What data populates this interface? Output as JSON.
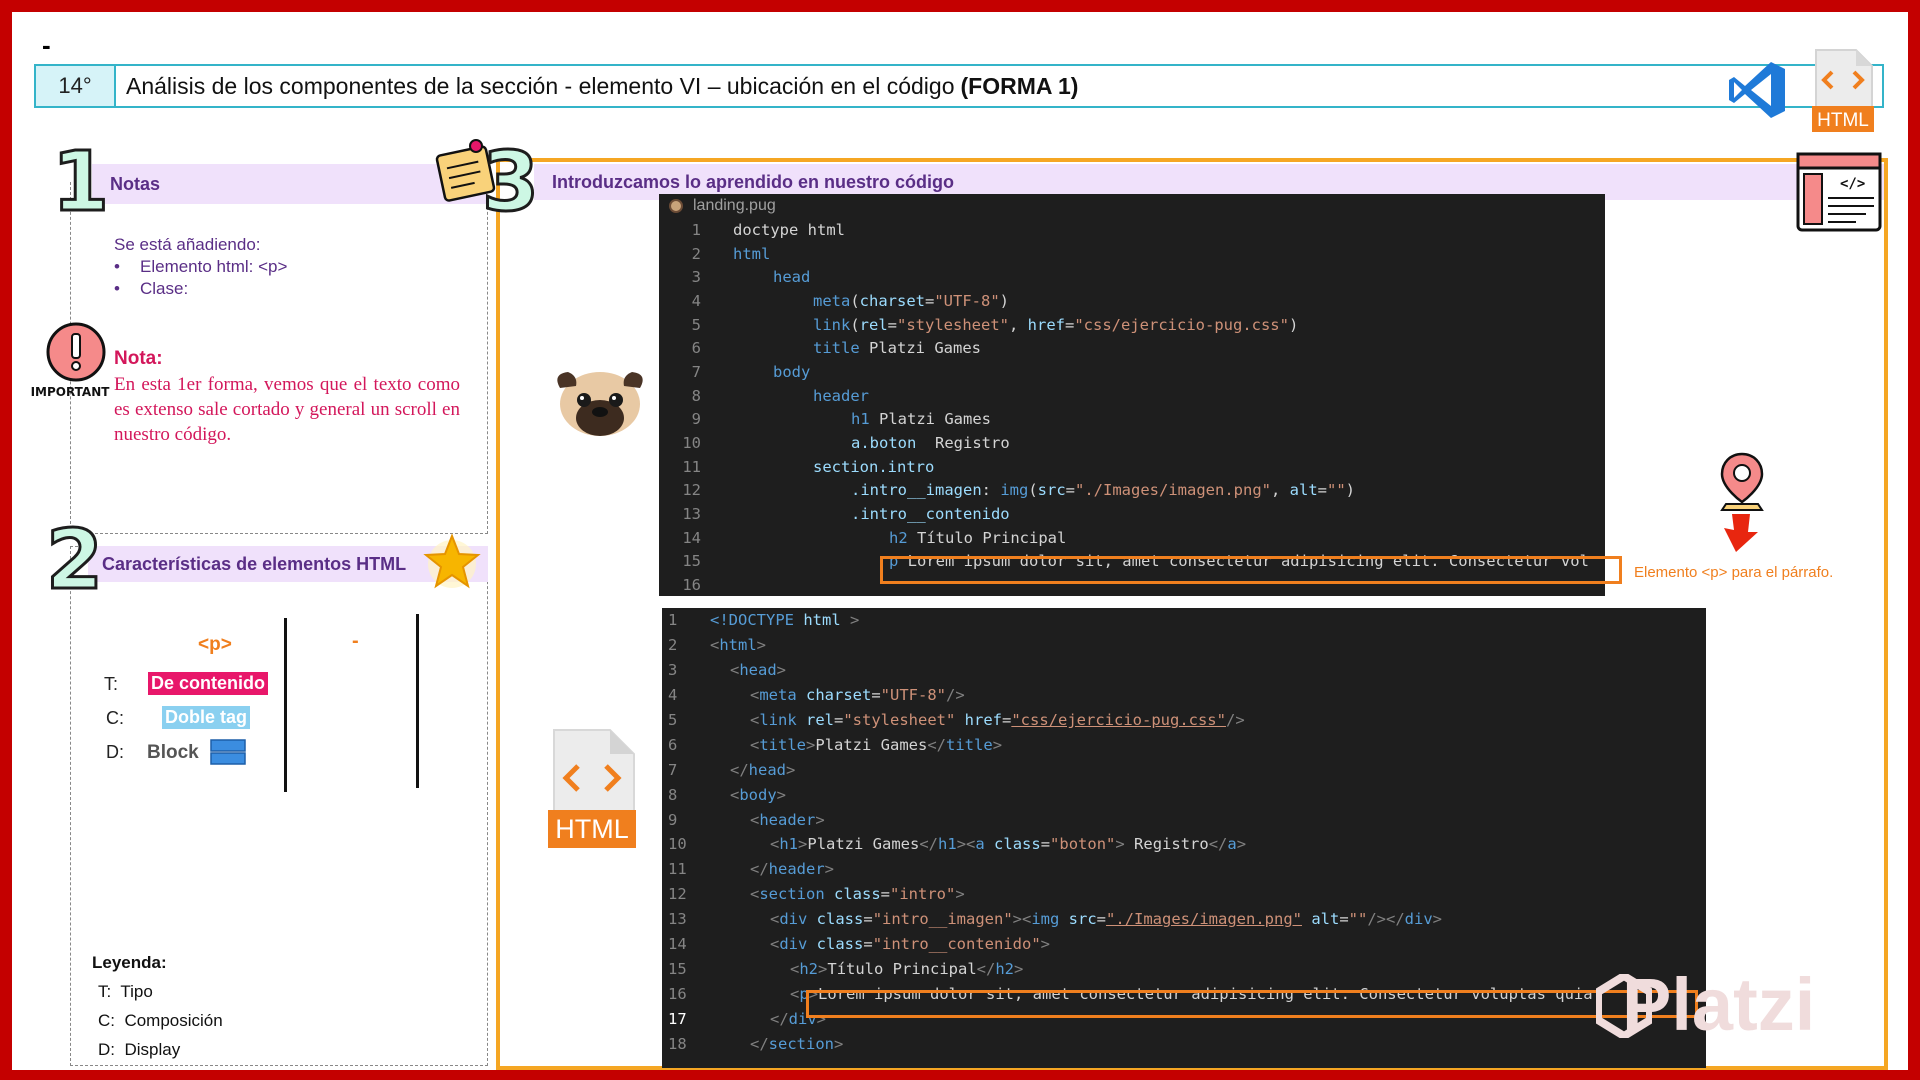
{
  "top": {
    "dash": "-"
  },
  "title_bar": {
    "number": "14°",
    "text": "Análisis de los componentes de la sección   - elemento VI – ubicación en el código",
    "bold_text": "(FORMA 1)"
  },
  "icons": {
    "vscode": "vscode-logo-icon",
    "html_file": "html-file-icon",
    "html_file_label": "HTML"
  },
  "notes": {
    "number": "1",
    "heading": "Notas",
    "intro": "Se está añadiendo:",
    "items": [
      "Elemento html: <p>",
      "Clase:"
    ],
    "important_label": "IMPORTANT",
    "nota_title": "Nota:",
    "nota_text": "En esta 1er forma, vemos que el texto como es extenso sale cortado y general un scroll en nuestro código."
  },
  "features": {
    "number": "2",
    "heading": "Características de elementos HTML",
    "column1_tag": "<p>",
    "column2_tag": "-",
    "rows": [
      {
        "label": "T:",
        "value": "De contenido"
      },
      {
        "label": "C:",
        "value": "Doble tag"
      },
      {
        "label": "D:",
        "value": "Block"
      }
    ],
    "legend_title": "Leyenda:",
    "legend": [
      {
        "key": "T:",
        "text": "Tipo"
      },
      {
        "key": "C:",
        "text": "Composición"
      },
      {
        "key": "D:",
        "text": "Display"
      }
    ]
  },
  "right": {
    "number": "3",
    "heading": "Introduzcamos lo aprendido en nuestro código",
    "pug_file_name": "landing.pug",
    "annotation": "Elemento <p> para el párrafo.",
    "watermark": "Platzi"
  },
  "pug_code": [
    {
      "n": "1"
    },
    {
      "n": "2"
    },
    {
      "n": "3"
    },
    {
      "n": "4"
    },
    {
      "n": "5"
    },
    {
      "n": "6"
    },
    {
      "n": "7"
    },
    {
      "n": "8"
    },
    {
      "n": "9"
    },
    {
      "n": "10"
    },
    {
      "n": "11"
    },
    {
      "n": "12"
    },
    {
      "n": "13"
    },
    {
      "n": "14"
    },
    {
      "n": "15"
    },
    {
      "n": "16"
    }
  ],
  "html_code": [
    {
      "n": "1"
    },
    {
      "n": "2"
    },
    {
      "n": "3"
    },
    {
      "n": "4"
    },
    {
      "n": "5"
    },
    {
      "n": "6"
    },
    {
      "n": "7"
    },
    {
      "n": "8"
    },
    {
      "n": "9"
    },
    {
      "n": "10"
    },
    {
      "n": "11"
    },
    {
      "n": "12"
    },
    {
      "n": "13"
    },
    {
      "n": "14"
    },
    {
      "n": "15"
    },
    {
      "n": "16"
    },
    {
      "n": "17"
    },
    {
      "n": "18"
    }
  ],
  "pug_src": {
    "l1a": "doctype",
    "l1b": " html",
    "l2": "html",
    "l3": "head",
    "l4a": "meta",
    "l4b": "(",
    "l4c": "charset",
    "l4d": "=",
    "l4e": "\"UTF-8\"",
    "l4f": ")",
    "l5a": "link",
    "l5b": "(",
    "l5c": "rel",
    "l5d": "=",
    "l5e": "\"stylesheet\"",
    "l5f": ", ",
    "l5g": "href",
    "l5h": "=",
    "l5i": "\"css/ejercicio-pug.css\"",
    "l5j": ")",
    "l6a": "title",
    "l6b": " Platzi Games",
    "l7": "body",
    "l8": "header",
    "l9a": "h1",
    "l9b": " Platzi Games",
    "l10a": "a.boton",
    "l10b": "  Registro",
    "l11": "section.intro",
    "l12a": ".intro__imagen",
    "l12b": ": ",
    "l12c": "img",
    "l12d": "(",
    "l12e": "src",
    "l12f": "=",
    "l12g": "\"./Images/imagen.png\"",
    "l12h": ", ",
    "l12i": "alt",
    "l12j": "=",
    "l12k": "\"\"",
    "l12l": ")",
    "l13": ".intro__contenido",
    "l14a": "h2",
    "l14b": " Título Principal",
    "l15a": "p",
    "l15b": " Lorem ipsum dolor sit, amet consectetur adipisicing elit. Consectetur vol"
  },
  "html_src": {
    "l1a": "<!DOCTYPE",
    "l1b": " html",
    "l1c": " >",
    "l2": "html",
    "l3": "head",
    "l4a": "meta",
    "l4b": " charset",
    "l4c": "=",
    "l4d": "\"UTF-8\"",
    "l5a": "link",
    "l5b": " rel",
    "l5c": "=",
    "l5d": "\"stylesheet\"",
    "l5e": " href",
    "l5f": "=",
    "l5g": "\"css/ejercicio-pug.css\"",
    "l6a": "title",
    "l6b": "Platzi Games",
    "l6c": "title",
    "l7": "head",
    "l8": "body",
    "l9": "header",
    "l10a": "h1",
    "l10b": "Platzi Games",
    "l10c": "h1",
    "l10d": "a",
    "l10e": " class",
    "l10f": "=",
    "l10g": "\"boton\"",
    "l10h": " Registro",
    "l10i": "a",
    "l11": "header",
    "l12a": "section",
    "l12b": " class",
    "l12c": "=",
    "l12d": "\"intro\"",
    "l13a": "div",
    "l13b": " class",
    "l13c": "=",
    "l13d": "\"intro__imagen\"",
    "l13e": "img",
    "l13f": " src",
    "l13g": "=",
    "l13h": "\"./Images/imagen.png\"",
    "l13i": " alt",
    "l13j": "=",
    "l13k": "\"\"",
    "l13l": "div",
    "l14a": "div",
    "l14b": " class",
    "l14c": "=",
    "l14d": "\"intro__contenido\"",
    "l15a": "h2",
    "l15b": "Título Principal",
    "l15c": "h2",
    "l16a": "p",
    "l16b": "Lorem ipsum dolor sit, amet consectetur adipisicing elit. Consectetur voluptas quia",
    "l17": "div",
    "l18": "section"
  }
}
